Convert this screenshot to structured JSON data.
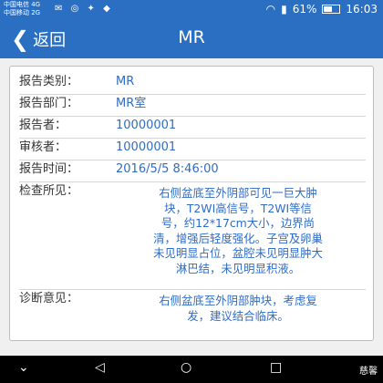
{
  "status_bar": {
    "carrier1": "中国电信 4G",
    "carrier2": "中国移动 2G",
    "battery": "61%",
    "time": "16:03"
  },
  "nav": {
    "back_label": "返回",
    "title": "MR"
  },
  "report": {
    "fields": [
      {
        "label": "报告类别：",
        "value": "MR"
      },
      {
        "label": "报告部门：",
        "value": "MR室"
      },
      {
        "label": "报告者：",
        "value": "10000001"
      },
      {
        "label": "审核者：",
        "value": "10000001"
      },
      {
        "label": "报告时间：",
        "value": "2016/5/5 8:46:00"
      }
    ],
    "findings_label": "检查所见：",
    "findings_lines": [
      "右侧盆底至外阴部可见一巨大肿",
      "块，T2WI高信号，T2WI等信",
      "号，约12*17cm大小，边界尚",
      "清，增强后轻度强化。子宫及卵巢",
      "未见明显占位，盆腔未见明显肿大",
      "淋巴结，未见明显积液。"
    ],
    "diagnosis_label": "诊断意见：",
    "diagnosis_lines": [
      "右侧盆底至外阴部肿块，考虑复",
      "发，建议结合临床。"
    ]
  },
  "watermark": "慈馨"
}
